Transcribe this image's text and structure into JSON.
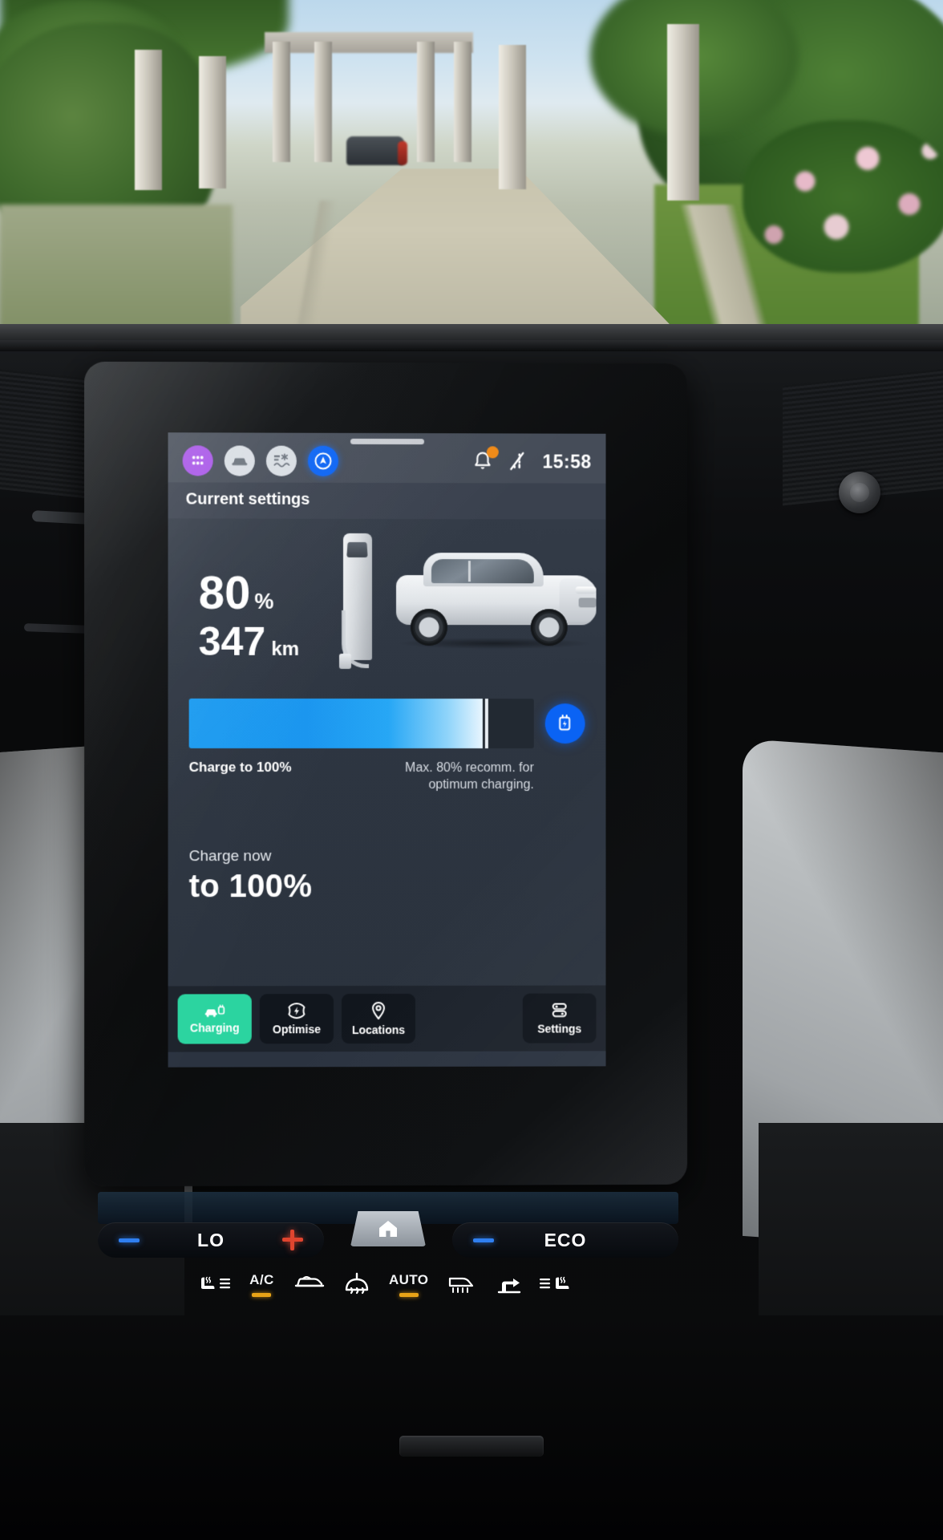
{
  "scene": {
    "description": "Car infotainment touchscreen photographed from driver seat, garden driveway visible through windshield"
  },
  "statusbar": {
    "icons": [
      {
        "name": "apps-grid-icon",
        "label": "Apps"
      },
      {
        "name": "vehicle-icon",
        "label": "Vehicle"
      },
      {
        "name": "climate-icon",
        "label": "Climate"
      },
      {
        "name": "navigation-icon",
        "label": "Navigation"
      }
    ],
    "notification": {
      "name": "bell-icon",
      "badge": true,
      "badge_color": "#f08a17"
    },
    "signal": {
      "name": "signal-off-icon"
    },
    "clock": "15:58"
  },
  "header": {
    "title": "Current settings"
  },
  "battery": {
    "percent_value": "80",
    "percent_unit": "%",
    "range_value": "347",
    "range_unit": "km"
  },
  "slider": {
    "fill_percent": 85,
    "left_label": "Charge to 100%",
    "right_label_line1": "Max. 80% recomm. for",
    "right_label_line2": "optimum charging.",
    "button_icon": "charge-plug-icon",
    "button_color": "#0a63f4"
  },
  "charge_now": {
    "subtitle": "Charge now",
    "value": "to 100%"
  },
  "tabs": [
    {
      "label": "Charging",
      "icon": "car-charging-icon",
      "active": true,
      "color": "#2bd4a0"
    },
    {
      "label": "Optimise",
      "icon": "bolt-shield-icon",
      "active": false
    },
    {
      "label": "Locations",
      "icon": "map-pin-icon",
      "active": false
    },
    {
      "label": "Settings",
      "icon": "sliders-icon",
      "active": false
    }
  ],
  "climate": {
    "left": {
      "minus": "−",
      "value": "LO",
      "plus": "+"
    },
    "home_button": "home-icon",
    "right": {
      "minus": "−",
      "value": "ECO"
    }
  },
  "hardware_buttons": [
    {
      "name": "seat-heat-left-button",
      "label": "",
      "icon": "seat-heat-icon",
      "indicator": false
    },
    {
      "name": "ac-button",
      "label": "A/C",
      "icon": "text-label",
      "indicator": true
    },
    {
      "name": "recirculate-button",
      "label": "",
      "icon": "recirculate-icon",
      "indicator": false
    },
    {
      "name": "defrost-front-button",
      "label": "",
      "icon": "defrost-front-icon",
      "indicator": false
    },
    {
      "name": "auto-button",
      "label": "AUTO",
      "icon": "text-label",
      "indicator": true
    },
    {
      "name": "defrost-rear-button",
      "label": "",
      "icon": "defrost-rear-icon",
      "indicator": false
    },
    {
      "name": "airflow-button",
      "label": "",
      "icon": "airflow-icon",
      "indicator": false
    },
    {
      "name": "seat-heat-right-button",
      "label": "",
      "icon": "seat-heat-icon",
      "indicator": false
    }
  ]
}
